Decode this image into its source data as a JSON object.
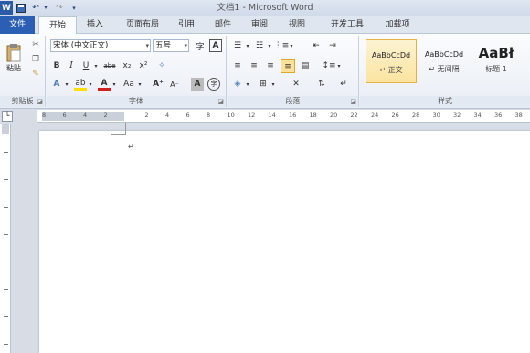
{
  "window": {
    "title": "文档1 - Microsoft Word",
    "logo": "W"
  },
  "quick_access": {
    "save": "save-icon",
    "undo": "undo-icon",
    "redo": "redo-icon",
    "customize": "customize-icon"
  },
  "tabs": [
    "文件",
    "开始",
    "插入",
    "页面布局",
    "引用",
    "邮件",
    "审阅",
    "视图",
    "开发工具",
    "加载项"
  ],
  "clipboard": {
    "paste_label": "粘贴",
    "group_label": "剪贴板"
  },
  "font": {
    "name": "宋体 (中文正文)",
    "size": "五号",
    "group_label": "字体",
    "bold": "B",
    "italic": "I",
    "underline": "U",
    "strike": "abe",
    "sub": "x₂",
    "sup": "x²",
    "aa": "Aa",
    "grow": "A⁺",
    "shrink": "A⁻",
    "char_shading": "A",
    "wen": "字"
  },
  "paragraph": {
    "group_label": "段落"
  },
  "styles": {
    "group_label": "样式",
    "items": [
      {
        "sample": "AaBbCcDd",
        "name": "↵ 正文"
      },
      {
        "sample": "AaBbCcDd",
        "name": "↵ 无间隔"
      },
      {
        "sample": "AaBł",
        "name": "标题 1"
      }
    ]
  },
  "ruler": {
    "numbers": [
      "8",
      "6",
      "4",
      "2",
      "",
      "2",
      "4",
      "6",
      "8",
      "10",
      "12",
      "14",
      "16",
      "18",
      "20",
      "22",
      "24",
      "26",
      "28",
      "30",
      "32",
      "34",
      "36",
      "38"
    ]
  },
  "colors": {
    "file_tab": "#2b5fb4",
    "accent_red": "#d02020",
    "highlight": "#ffe000"
  }
}
